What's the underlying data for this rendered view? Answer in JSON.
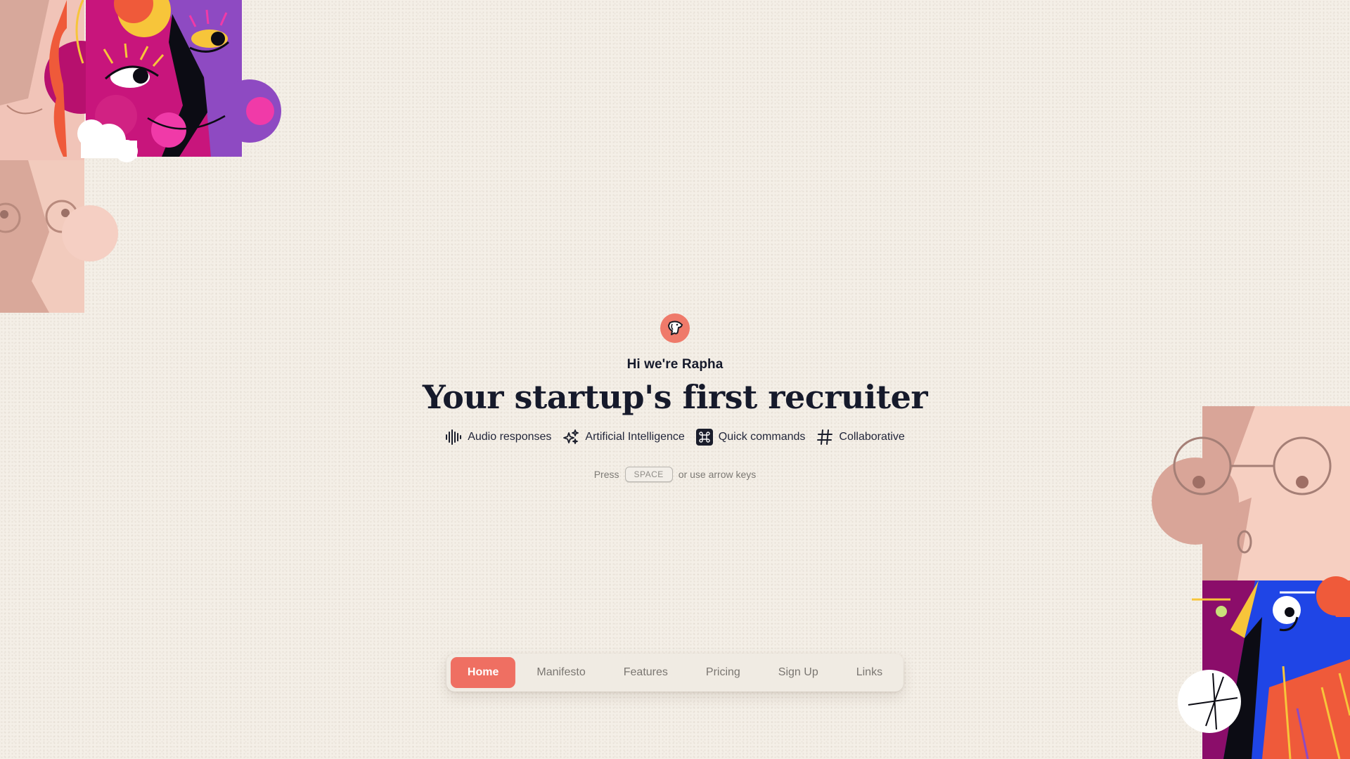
{
  "hero": {
    "greeting": "Hi we're Rapha",
    "headline": "Your startup's first recruiter",
    "features": [
      {
        "icon": "audio-waveform-icon",
        "label": "Audio responses"
      },
      {
        "icon": "sparkles-icon",
        "label": "Artificial Intelligence"
      },
      {
        "icon": "command-key-icon",
        "label": "Quick commands"
      },
      {
        "icon": "hash-icon",
        "label": "Collaborative"
      }
    ],
    "hint": {
      "prefix": "Press",
      "key": "SPACE",
      "suffix": "or use arrow keys"
    }
  },
  "nav": {
    "items": [
      {
        "label": "Home",
        "active": true
      },
      {
        "label": "Manifesto",
        "active": false
      },
      {
        "label": "Features",
        "active": false
      },
      {
        "label": "Pricing",
        "active": false
      },
      {
        "label": "Sign Up",
        "active": false
      },
      {
        "label": "Links",
        "active": false
      }
    ]
  },
  "colors": {
    "background": "#f4efe7",
    "accent": "#ef6f62",
    "text": "#161a2b"
  }
}
